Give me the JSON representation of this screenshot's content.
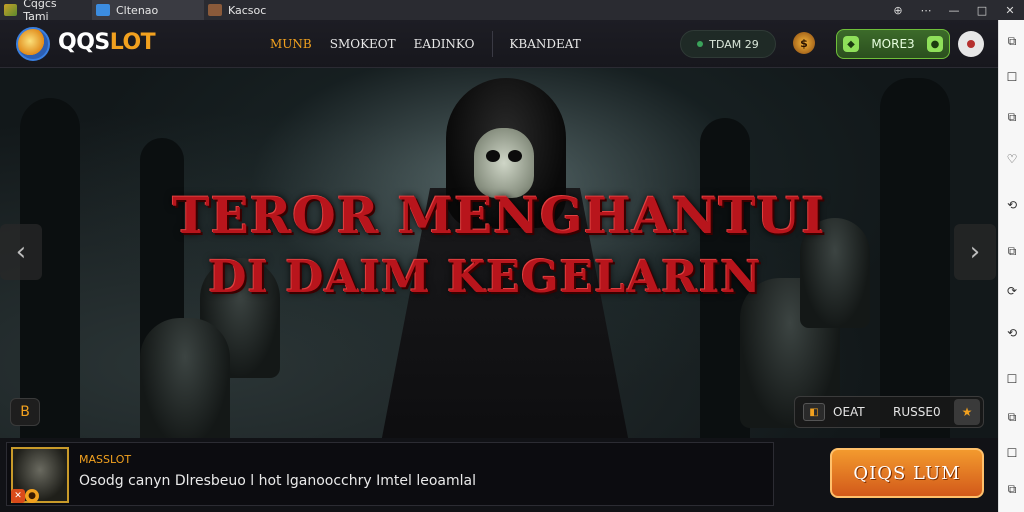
{
  "browser": {
    "tabs": [
      {
        "label": "Cqgcs Tami",
        "icon": "leaf-favicon-icon"
      },
      {
        "label": "Cltenao",
        "icon": "cloud-favicon-icon"
      },
      {
        "label": "Kacsoc",
        "icon": "game-favicon-icon"
      }
    ],
    "window_controls": [
      "⊕",
      "⋯",
      "—",
      "□",
      "✕"
    ]
  },
  "header": {
    "brand_main": "QQS",
    "brand_accent": "LOT",
    "nav": [
      "MUNB",
      "SMOKEOT",
      "EADINKO",
      "KBANDEAT"
    ],
    "timer_label": "TDAM 29",
    "coin_label": "$",
    "more_label": "MORE3"
  },
  "hero": {
    "title_line1": "TEROR MENGHANTUI",
    "title_line2": "DI DAIM KEGELARIN",
    "prev_arrow": "‹",
    "next_arrow": "›",
    "left_badge": "B",
    "pill_label1": "OEAT",
    "pill_label2": "RUSSE0",
    "pill_star": "★"
  },
  "bottom": {
    "ticker_title": "MASSLOT",
    "ticker_text": "Osodg canyn Dlresbeuo l hot lganoocchry Imtel leoamlal",
    "cta_label": "QIQS LUM"
  },
  "rail": {
    "icons": [
      "⧉",
      "☐",
      "⧉",
      "♡",
      "⟲",
      "⧉",
      "⟳",
      "⟲",
      "☐",
      "⧉",
      "☐",
      "⧉"
    ]
  },
  "colors": {
    "accent": "#f2a11f",
    "title_red": "#b8151c",
    "cta": "#e07a22",
    "more_green": "#6fbf3a"
  }
}
